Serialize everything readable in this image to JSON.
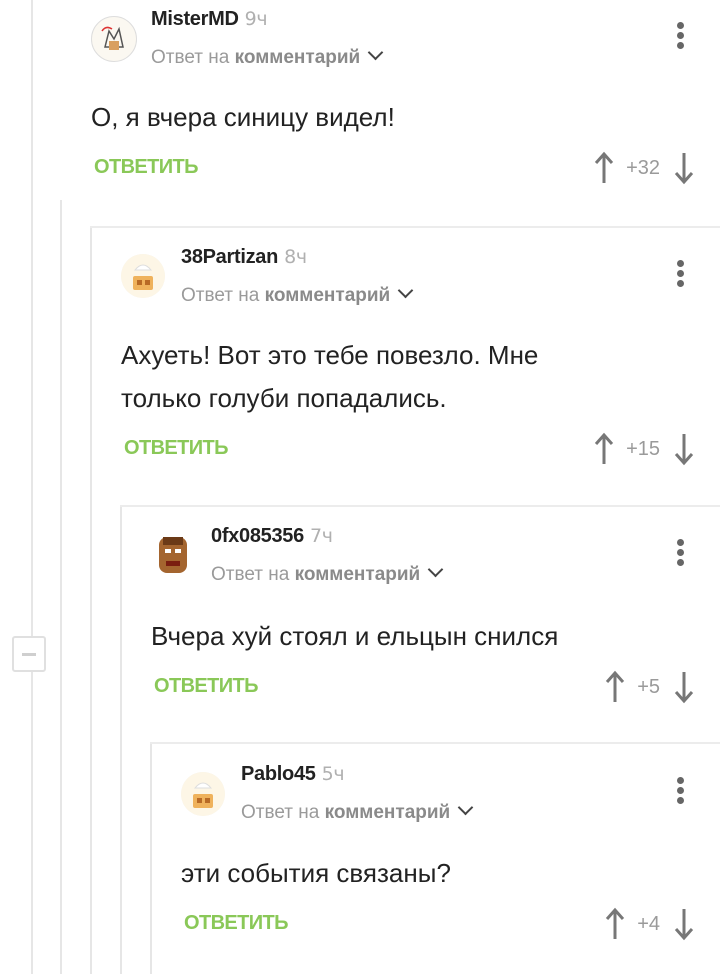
{
  "comments": [
    {
      "nick": "MisterMD",
      "time": "9ч",
      "reply_prefix": "Ответ на",
      "reply_link": "комментарий",
      "text": "О, я вчера синицу видел!",
      "reply_label": "ОТВЕТИТЬ",
      "score": "+32"
    },
    {
      "nick": "38Partizan",
      "time": "8ч",
      "reply_prefix": "Ответ на",
      "reply_link": "комментарий",
      "text": "Ахуеть! Вот это тебе повезло. Мне только голуби попадались.",
      "reply_label": "ОТВЕТИТЬ",
      "score": "+15"
    },
    {
      "nick": "0fx085356",
      "time": "7ч",
      "reply_prefix": "Ответ на",
      "reply_link": "комментарий",
      "text": "Вчера хуй стоял и ельцын снился",
      "reply_label": "ОТВЕТИТЬ",
      "score": "+5"
    },
    {
      "nick": "Pablo45",
      "time": "5ч",
      "reply_prefix": "Ответ на",
      "reply_link": "комментарий",
      "text": "эти события связаны?",
      "reply_label": "ОТВЕТИТЬ",
      "score": "+4"
    }
  ],
  "colors": {
    "reply_green": "#8ac858",
    "tree_line": "#e6e6e6",
    "muted": "#9a9a9a"
  },
  "icons": [
    "more-vertical-icon",
    "chevron-down-icon",
    "arrow-up-icon",
    "arrow-down-icon",
    "collapse-minus-icon"
  ]
}
